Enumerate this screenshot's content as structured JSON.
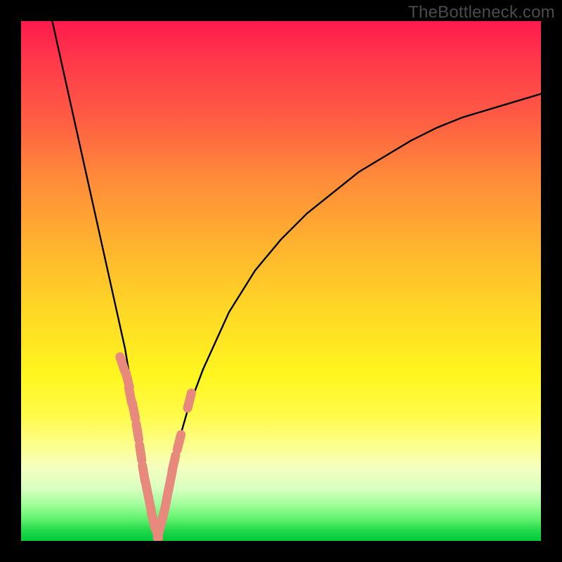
{
  "watermark": "TheBottleneck.com",
  "chart_data": {
    "type": "line",
    "title": "",
    "xlabel": "",
    "ylabel": "",
    "xlim": [
      0,
      100
    ],
    "ylim": [
      0,
      100
    ],
    "grid": false,
    "legend": false,
    "description": "V-shaped bottleneck curve over a vertical rainbow gradient (red top = high bottleneck, green bottom = low). Two black curve arms descend to a minimum near x≈26 then rise. Salmon-colored data markers cluster near the minimum on both arms.",
    "series": [
      {
        "name": "left-arm",
        "x": [
          6,
          8,
          10,
          12,
          14,
          16,
          18,
          20,
          22,
          23,
          24,
          25,
          26
        ],
        "values": [
          100,
          91,
          82,
          73,
          64,
          55,
          46,
          37,
          25,
          18,
          11,
          5,
          1
        ]
      },
      {
        "name": "right-arm",
        "x": [
          26,
          27,
          28,
          29,
          30,
          32,
          35,
          40,
          45,
          50,
          55,
          60,
          65,
          70,
          75,
          80,
          85,
          90,
          95,
          100
        ],
        "values": [
          1,
          4,
          8,
          13,
          18,
          25,
          33,
          44,
          52,
          58,
          63,
          67,
          71,
          74,
          77,
          79.5,
          81.5,
          83,
          84.5,
          86
        ]
      },
      {
        "name": "markers-left",
        "x": [
          19.5,
          20.5,
          21.0,
          21.7,
          22.4,
          23.0,
          23.6,
          24.2,
          24.8,
          25.4,
          26.0
        ],
        "values": [
          34,
          31,
          28,
          25,
          21,
          17,
          13,
          10,
          7,
          4,
          2
        ]
      },
      {
        "name": "markers-right",
        "x": [
          26.6,
          27.1,
          27.6,
          28.2,
          28.8,
          29.4,
          30.4,
          32.4
        ],
        "values": [
          2,
          4,
          6,
          9,
          12,
          15,
          19,
          27
        ]
      }
    ],
    "colors": {
      "curve": "#000000",
      "markers": "#e8897d"
    }
  }
}
